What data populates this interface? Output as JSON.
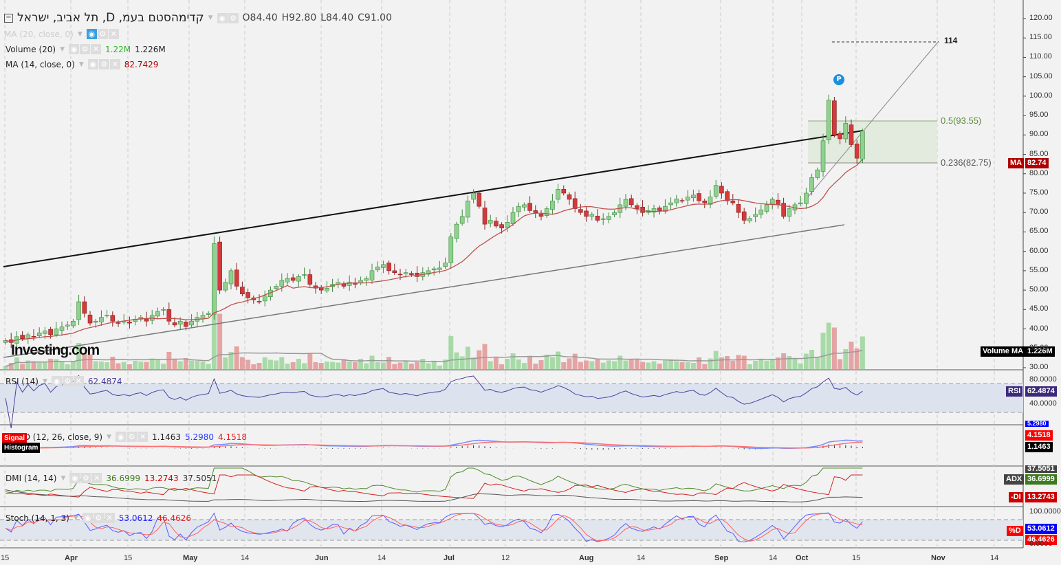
{
  "header": {
    "symbol_title": "קדימהסטם בעמ, D, תל אביב, ישראל",
    "open": "O84.40",
    "high": "H92.80",
    "low": "L84.40",
    "close": "C91.00"
  },
  "legends": {
    "ma20": "MA (20, close, 0)",
    "volume": "Volume (20)",
    "volume_v1": "1.22M",
    "volume_v2": "1.226M",
    "ma14": "MA (14, close, 0)",
    "ma14_v": "82.7429",
    "rsi": "RSI (14)",
    "rsi_v": "62.4874",
    "macd": "MACD (12, 26, close, 9)",
    "macd_hist": "1.1463",
    "macd_v": "5.2980",
    "macd_signal": "4.1518",
    "macd_tag_signal": "Signal",
    "macd_tag_hist": "Histogram",
    "dmi": "DMI (14, 14)",
    "dmi_plus": "36.6999",
    "dmi_minus": "13.2743",
    "dmi_adx": "37.5051",
    "stoch": "Stoch (14, 1, 3)",
    "stoch_k": "53.0612",
    "stoch_d": "46.4626"
  },
  "tags": {
    "ma": "MA",
    "ma_v": "82.74",
    "volume_ma": "Volume MA",
    "volume_ma_v": "1.226M",
    "rsi": "RSI",
    "rsi_v": "62.4874",
    "macd_top": "5.2980",
    "macd_signal_v": "4.1518",
    "macd_hist_v": "1.1463",
    "adx_top": "37.5051",
    "adx": "ADX",
    "adx_v": "36.6999",
    "di": "-DI",
    "di_v": "13.2743",
    "stoch_d": "%D",
    "stoch_k_v": "53.0612",
    "stoch_d_v": "46.4626"
  },
  "annotations": {
    "peak_label": "114",
    "fib_05": "0.5(93.55)",
    "fib_0236": "0.236(82.75)",
    "marker": "P"
  },
  "logo": "Investing.com",
  "colors": {
    "up": "#8fd18f",
    "down": "#d43a3a",
    "ma": "#c0504d",
    "rsi": "#4b3f9b",
    "macd": "#3b5bff",
    "signal": "#ff4040"
  },
  "chart_data": {
    "type": "candlestick",
    "title": "קדימהסטם בעמ, D, תל אביב, ישראל",
    "ylim": [
      30,
      120
    ],
    "y_ticks": [
      "120.00",
      "115.00",
      "110.00",
      "105.00",
      "100.00",
      "95.00",
      "90.00",
      "85.00",
      "80.00",
      "75.00",
      "70.00",
      "65.00",
      "60.00",
      "55.00",
      "50.00",
      "45.00",
      "40.00",
      "35.00",
      "30.00"
    ],
    "x_ticks": [
      "15",
      "Apr",
      "15",
      "May",
      "14",
      "Jun",
      "14",
      "Jul",
      "12",
      "Aug",
      "14",
      "Sep",
      "14",
      "Oct",
      "15",
      "Nov",
      "14"
    ],
    "rsi_ticks": [
      "80.0000",
      "40.0000"
    ],
    "stoch_ticks": [
      "100.0000",
      "0.0000"
    ],
    "closes": [
      37,
      36.5,
      38,
      37.5,
      38.5,
      38,
      39,
      39.5,
      38.5,
      40,
      40.5,
      41,
      42,
      47,
      44,
      41.5,
      42,
      43,
      43.5,
      42,
      41.5,
      42,
      41.5,
      42.5,
      43,
      42,
      43.5,
      44.5,
      45,
      42,
      41,
      42,
      40.6,
      42,
      43,
      43.5,
      44,
      62,
      50,
      52,
      55,
      51,
      49,
      48,
      47.5,
      47,
      48.5,
      50,
      51,
      52.5,
      53,
      52.5,
      53.5,
      54,
      51.5,
      50.5,
      50,
      50.5,
      51.5,
      52,
      51,
      52,
      51.5,
      52.5,
      53,
      55,
      56,
      56.6,
      55,
      54.5,
      54,
      54.5,
      54,
      53.5,
      54.5,
      55,
      55.5,
      55.7,
      57,
      63.7,
      67,
      69,
      73,
      75,
      71.6,
      67,
      68,
      66.5,
      66,
      67.5,
      70,
      71.6,
      72,
      70.5,
      70,
      69,
      71,
      73,
      76,
      75,
      73.4,
      71,
      70,
      69,
      69.5,
      68,
      68.4,
      69,
      70,
      72,
      73.4,
      72,
      71,
      70,
      70.5,
      71,
      70.5,
      71.6,
      72.5,
      73.5,
      73,
      74,
      74.5,
      73,
      72.5,
      74,
      77,
      75,
      73,
      72.5,
      70,
      68,
      68.5,
      69.5,
      70.7,
      72,
      73.4,
      72,
      69,
      71,
      72,
      72.5,
      75,
      79,
      81,
      88.5,
      99,
      90,
      89,
      93,
      87.5,
      84,
      91
    ]
  }
}
